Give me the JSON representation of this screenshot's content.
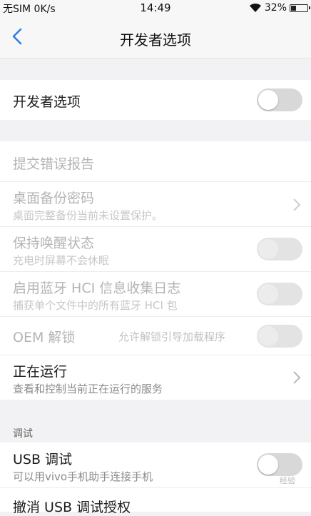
{
  "status_bar": {
    "carrier": "无SIM 0K/s",
    "time": "14:49",
    "battery": "32%",
    "battery_level": 0.32
  },
  "header": {
    "title": "开发者选项"
  },
  "master_toggle": {
    "label": "开发者选项",
    "on": false
  },
  "items": {
    "bug_report": {
      "label": "提交错误报告"
    },
    "backup_password": {
      "label": "桌面备份密码",
      "sub": "桌面完整备份当前未设置保护。"
    },
    "stay_awake": {
      "label": "保持唤醒状态",
      "sub": "充电时屏幕不会休眠",
      "on": false
    },
    "bt_hci_log": {
      "label": "启用蓝牙 HCI 信息收集日志",
      "sub": "捕获单个文件中的所有蓝牙 HCI 包",
      "on": false
    },
    "oem_unlock": {
      "label": "OEM 解锁",
      "hint": "允许解锁引导加载程序",
      "on": false
    },
    "running_services": {
      "label": "正在运行",
      "sub": "查看和控制当前正在运行的服务"
    }
  },
  "debug_section": {
    "header": "调试",
    "usb_debugging": {
      "label": "USB 调试",
      "sub": "可以用vivo手机助手连接手机",
      "on": false
    },
    "revoke_usb": {
      "label": "撤消 USB 调试授权"
    }
  },
  "watermark": "经验",
  "colors": {
    "background": "#f2f2f4",
    "toggle_off": "#d8d8d8",
    "accent": "#2a7be4"
  }
}
